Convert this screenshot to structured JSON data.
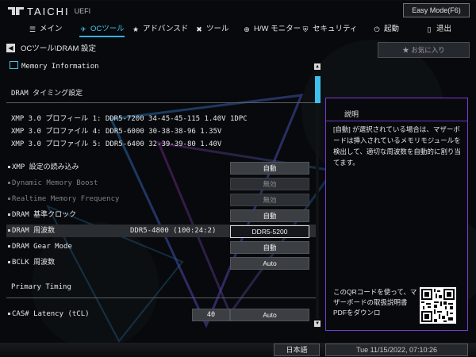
{
  "header": {
    "brand": "TAICHI",
    "brand_suffix": "UEFI",
    "easy_mode_label": "Easy Mode(F6)"
  },
  "nav": {
    "items": [
      {
        "label": "メイン",
        "icon": "menu-icon"
      },
      {
        "label": "OCツール",
        "icon": "rocket-icon",
        "active": true
      },
      {
        "label": "アドバンスド",
        "icon": "star-icon"
      },
      {
        "label": "ツール",
        "icon": "tools-icon"
      },
      {
        "label": "H/W モニター",
        "icon": "globe-icon"
      },
      {
        "label": "セキュリティ",
        "icon": "shield-icon"
      },
      {
        "label": "起動",
        "icon": "power-icon"
      },
      {
        "label": "退出",
        "icon": "exit-icon"
      }
    ]
  },
  "breadcrumb": "OCツール\\DRAM 設定",
  "favorites_label": "お気に入り",
  "panel": {
    "memory_info": "Memory Information",
    "dram_timing_title": "DRAM タイミング設定",
    "xmp_profiles": [
      "XMP 3.0 プロフィール 1: DDR5-7200 34-45-45-115 1.40V 1DPC",
      "XMP 3.0 プロファイル 4: DDR5-6000 30-38-38-96 1.35V",
      "XMP 3.0 プロファイル 5: DDR5-6400 32-39-39-80 1.40V"
    ],
    "settings": [
      {
        "label": "XMP 設定の読み込み",
        "value": "自動",
        "disabled": false
      },
      {
        "label": "Dynamic Memory Boost",
        "value": "無効",
        "disabled": true
      },
      {
        "label": "Realtime Memory Frequency",
        "value": "無効",
        "disabled": true
      },
      {
        "label": "DRAM 基準クロック",
        "value": "自動",
        "disabled": false
      },
      {
        "label": "DRAM 周波数",
        "info": "DDR5-4800 (100:24:2)",
        "value": "DDR5-5200",
        "disabled": false,
        "selected": true
      },
      {
        "label": "DRAM Gear Mode",
        "value": "自動",
        "disabled": false
      },
      {
        "label": "BCLK 周波数",
        "value": "Auto",
        "disabled": false
      }
    ],
    "primary_timing_title": "Primary Timing",
    "cas": {
      "label": "CAS# Latency (tCL)",
      "current": "40",
      "value": "Auto"
    }
  },
  "description": {
    "title": "説明",
    "text": "[自動] が選択されている場合は、マザーボードは挿入されているメモリモジュールを検出して、適切な周波数を自動的に割り当てます。",
    "qr_text": "このQRコードを使って、マザーボードの取扱説明書PDFをダウンロ"
  },
  "footer": {
    "language": "日本語",
    "datetime": "Tue 11/15/2022, 07:10:26"
  },
  "colors": {
    "accent": "#2fb3e6",
    "description_border": "#7a3bd6",
    "background": "#07090c"
  }
}
